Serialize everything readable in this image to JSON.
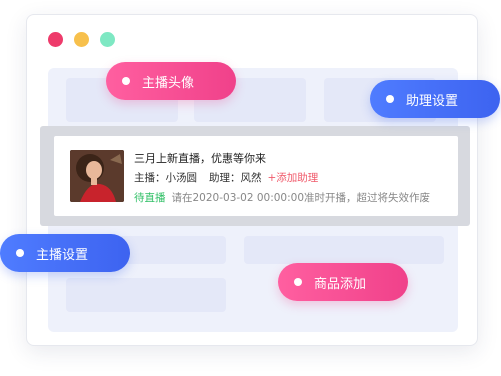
{
  "window": {
    "controls": [
      "close",
      "minimize",
      "maximize"
    ]
  },
  "live_card": {
    "title": "三月上新直播，优惠等你来",
    "host_label": "主播：小汤圆",
    "assistant_label": "助理：风然",
    "add_assistant": "+添加助理",
    "status": "待直播",
    "notice": "请在2020-03-02 00:00:00准时开播，超过将失效作废"
  },
  "callouts": {
    "host_avatar": "主播头像",
    "assistant_settings": "助理设置",
    "host_settings": "主播设置",
    "product_add": "商品添加"
  },
  "colors": {
    "pink": "#f0418a",
    "blue": "#3d63f0",
    "status_green": "#2fbf65",
    "add_red": "#f05a6b"
  }
}
